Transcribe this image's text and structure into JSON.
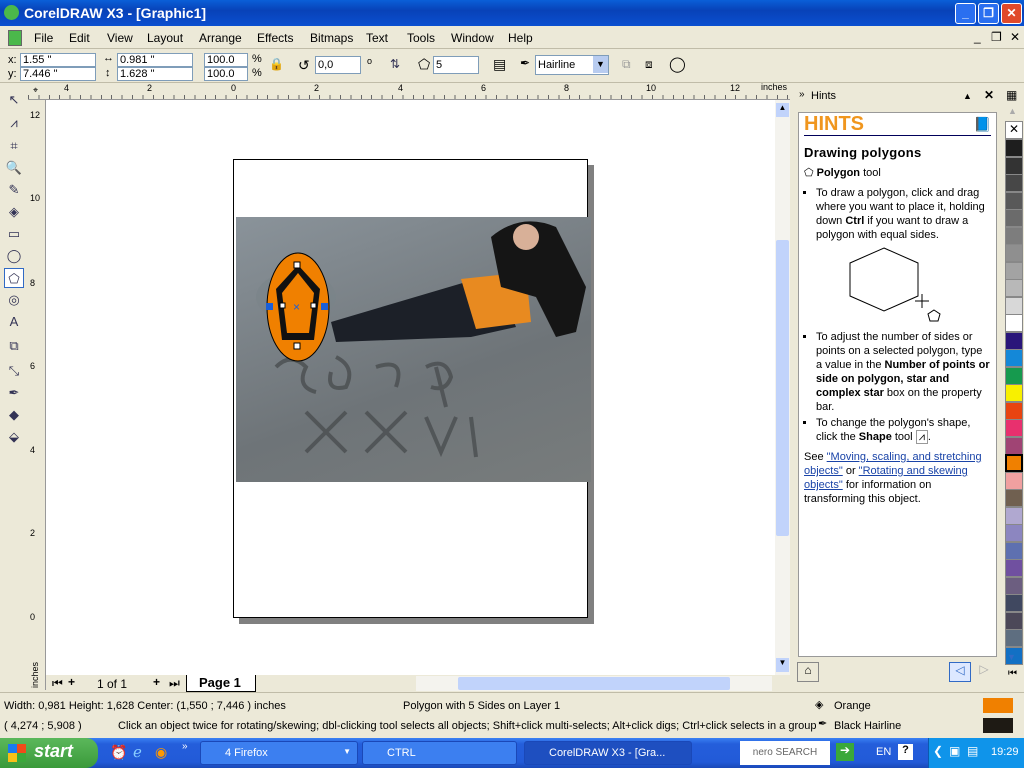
{
  "window": {
    "title": "CorelDRAW X3 - [Graphic1]"
  },
  "menu": [
    "File",
    "Edit",
    "View",
    "Layout",
    "Arrange",
    "Effects",
    "Bitmaps",
    "Text",
    "Tools",
    "Window",
    "Help"
  ],
  "propbar": {
    "x_label": "x:",
    "x": "1.55 \"",
    "y_label": "y:",
    "y": "7.446 \"",
    "width": "0.981 \"",
    "height": "1.628 \"",
    "scale_x": "100.0",
    "scale_y": "100.0",
    "pct": "%",
    "rotation": "0,0",
    "degree": "o",
    "sides": "5",
    "outline": "Hairline"
  },
  "ruler": {
    "h_ticks": [
      "4",
      "2",
      "0",
      "2",
      "4",
      "6",
      "8",
      "10",
      "12"
    ],
    "unit": "inches",
    "v_ticks": [
      "12",
      "10",
      "8",
      "6",
      "4",
      "2",
      "0"
    ],
    "v_unit": "inches"
  },
  "pagenav": {
    "count": "1 of 1",
    "tab": "Page 1"
  },
  "docker": {
    "title": "Hints",
    "heading": "HINTS",
    "subheading": "Drawing polygons",
    "tool_name": "Polygon",
    "tool_suffix": "tool",
    "b1_a": "To draw a polygon, click and drag where you want to place it, holding down ",
    "b1_bold": "Ctrl",
    "b1_b": " if you want to draw a polygon with equal sides.",
    "b2_a": "To adjust the number of sides or points on a selected polygon, type a value in the ",
    "b2_bold": "Number of points or side on polygon, star and complex star",
    "b2_b": " box on the property bar.",
    "b3_a": "To change the polygon's shape, click the ",
    "b3_bold": "Shape",
    "b3_b": " tool",
    "see": "See ",
    "link1": "\"Moving, scaling, and stretching objects\"",
    "or": " or ",
    "link2": "\"Rotating and skewing objects\"",
    "see_end": " for information on transforming this object."
  },
  "palette": [
    "#1e1e1e",
    "#333333",
    "#474747",
    "#595959",
    "#6b6b6b",
    "#7d7d7d",
    "#8f8f8f",
    "#a3a3a3",
    "#b8b8b8",
    "#d8d8d8",
    "#ffffff",
    "#2a167a",
    "#1488d8",
    "#169a4e",
    "#f8f000",
    "#e84410",
    "#e8306e",
    "#a04474",
    "#f08000",
    "#f0a0a0",
    "#706050",
    "#b0a8d0",
    "#8c86c0",
    "#5e70b0",
    "#7050a0",
    "#6c5e80",
    "#404860",
    "#4c4858",
    "#5e6e80",
    "#1270c4"
  ],
  "status": {
    "dims": "Width: 0,981  Height: 1,628  Center: (1,550 ; 7,446 )  inches",
    "object": "Polygon with 5 Sides on Layer 1",
    "coords": "( 4,274 ; 5,908 )",
    "hint": "Click an object twice for rotating/skewing; dbl-clicking tool selects all objects; Shift+click multi-selects; Alt+click digs; Ctrl+click selects in a group",
    "fill": "Orange",
    "fill_color": "#f08000",
    "outline": "Black  Hairline",
    "outline_color": "#1e1a14"
  },
  "taskbar": {
    "start": "start",
    "tasks": [
      "4 Firefox",
      "CTRL",
      "CorelDRAW X3 - [Gra..."
    ],
    "search": "nero SEARCH",
    "lang": "EN",
    "clock": "19:29"
  }
}
